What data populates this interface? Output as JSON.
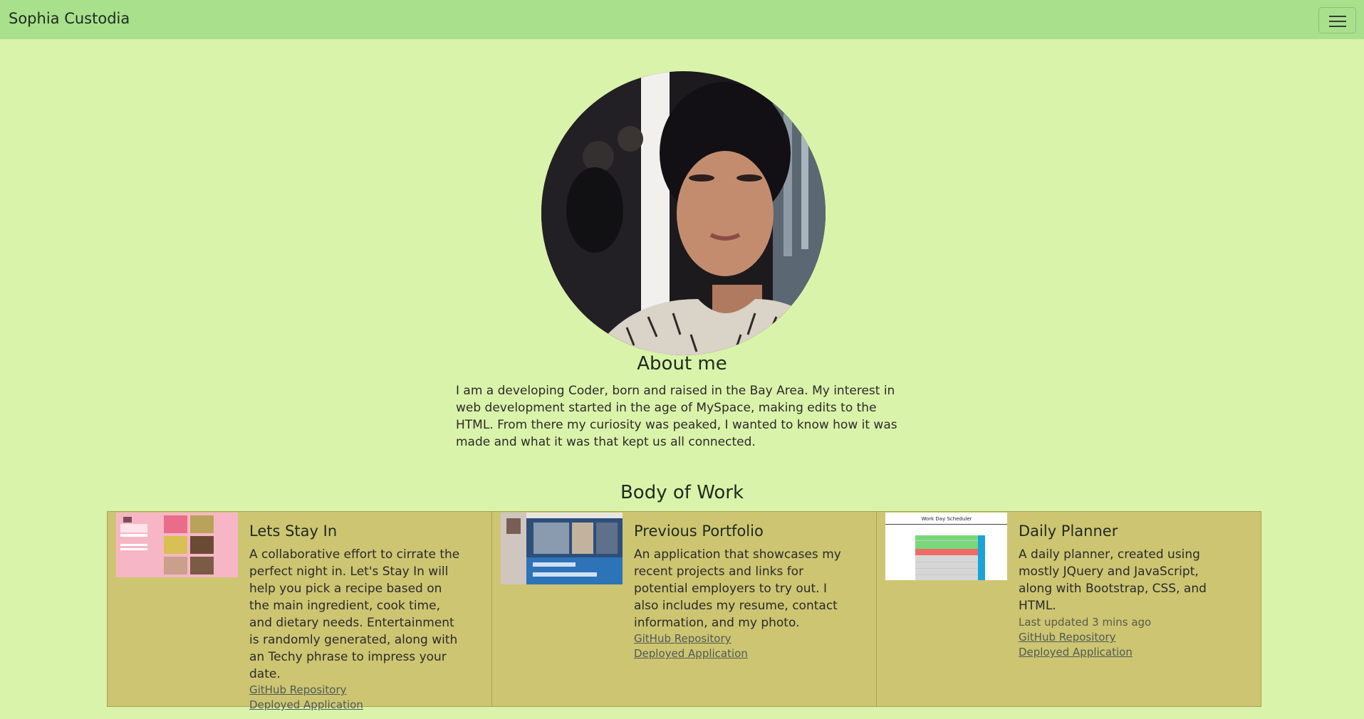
{
  "navbar": {
    "brand": "Sophia Custodia"
  },
  "about": {
    "title": "About me",
    "text": "I am a developing Coder, born and raised in the Bay Area. My interest in web development started in the age of MySpace, making edits to the HTML. From there my curiosity was peaked, I wanted to know how it was made and what it was that kept us all connected."
  },
  "work": {
    "title": "Body of Work",
    "cards": [
      {
        "title": "Lets Stay In",
        "text": "A collaborative effort to cirrate the perfect night in. Let's Stay In will help you pick a recipe based on the main ingredient, cook time, and dietary needs. Entertainment is randomly generated, along with an Techy phrase to impress your date.",
        "repo_label": "GitHub Repository",
        "app_label": "Deployed Application"
      },
      {
        "title": "Previous Portfolio",
        "text": "An application that showcases my recent projects and links for potential employers to try out. I also includes my resume, contact information, and my photo.",
        "repo_label": "GitHub Repository",
        "app_label": "Deployed Application"
      },
      {
        "title": "Daily Planner",
        "text": "A daily planner, created using mostly JQuery and JavaScript, along with Bootstrap, CSS, and HTML.",
        "updated": "Last updated 3 mins ago",
        "repo_label": "GitHub Repository",
        "app_label": "Deployed Application",
        "thumb_title": "Work Day Scheduler"
      }
    ]
  },
  "colors": {
    "navbar": "#a8e08c",
    "background": "#daf3aa",
    "card": "#cdc572"
  },
  "icons": {
    "menu": "hamburger-icon"
  }
}
